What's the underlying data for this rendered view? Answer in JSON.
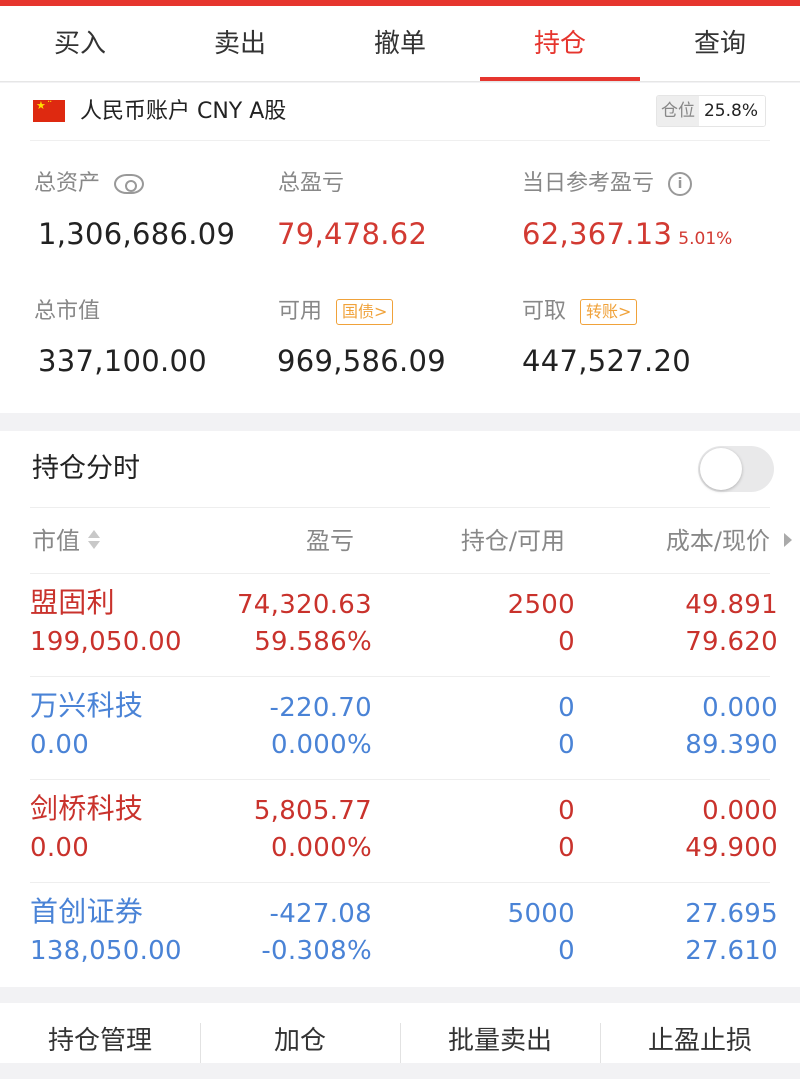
{
  "tabs": [
    {
      "label": "买入",
      "active": false
    },
    {
      "label": "卖出",
      "active": false
    },
    {
      "label": "撤单",
      "active": false
    },
    {
      "label": "持仓",
      "active": true
    },
    {
      "label": "查询",
      "active": false
    }
  ],
  "account": {
    "name": "人民币账户 CNY A股",
    "position_label": "仓位",
    "position_value": "25.8%",
    "total_assets_label": "总资产",
    "total_assets": "1,306,686.09",
    "total_pl_label": "总盈亏",
    "total_pl": "79,478.62",
    "today_pl_label": "当日参考盈亏",
    "today_pl": "62,367.13",
    "today_pl_pct": "5.01%",
    "market_value_label": "总市值",
    "market_value": "337,100.00",
    "available_label": "可用",
    "available_tag": "国债>",
    "available": "969,586.09",
    "withdrawable_label": "可取",
    "withdrawable_tag": "转账>",
    "withdrawable": "447,527.20"
  },
  "holdings": {
    "title": "持仓分时",
    "toggle_on": false,
    "columns": {
      "market_value": "市值",
      "pl": "盈亏",
      "hold": "持仓/可用",
      "cost": "成本/现价"
    },
    "rows": [
      {
        "name": "盟固利",
        "market_value": "199,050.00",
        "pl": "74,320.63",
        "pl_pct": "59.586%",
        "hold": "2500",
        "available": "0",
        "cost": "49.891",
        "price": "79.620",
        "trend": "up"
      },
      {
        "name": "万兴科技",
        "market_value": "0.00",
        "pl": "-220.70",
        "pl_pct": "0.000%",
        "hold": "0",
        "available": "0",
        "cost": "0.000",
        "price": "89.390",
        "trend": "down"
      },
      {
        "name": "剑桥科技",
        "market_value": "0.00",
        "pl": "5,805.77",
        "pl_pct": "0.000%",
        "hold": "0",
        "available": "0",
        "cost": "0.000",
        "price": "49.900",
        "trend": "up"
      },
      {
        "name": "首创证券",
        "market_value": "138,050.00",
        "pl": "-427.08",
        "pl_pct": "-0.308%",
        "hold": "5000",
        "available": "0",
        "cost": "27.695",
        "price": "27.610",
        "trend": "down"
      }
    ]
  },
  "bottom_buttons": [
    "持仓管理",
    "加仓",
    "批量卖出",
    "止盈止损"
  ],
  "colors": {
    "accent": "#e6352e",
    "up": "#c9322c",
    "down": "#4a83d6",
    "tag": "#f0a23a"
  }
}
